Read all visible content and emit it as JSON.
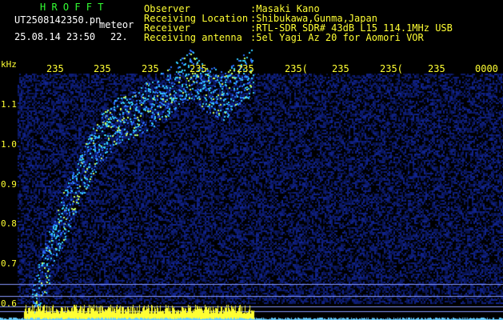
{
  "header": {
    "app_title": "H R O F F T",
    "file_name": "UT2508142350.pn",
    "event_type": "meteor",
    "date_time": "25.08.14 23:50",
    "count": "22.",
    "observer_label": "Observer",
    "observer_value": ":Masaki Kano",
    "location_label": "Receiving Location",
    "location_value": ":Shibukawa,Gunma,Japan",
    "receiver_label": "Receiver",
    "receiver_value": ":RTL-SDR SDR# 43dB L15 114.1MHz USB",
    "antenna_label": "Receiving antenna",
    "antenna_value": ":5el Yagi Az 20 for Aomori VOR"
  },
  "spectrogram": {
    "y_unit": "kHz",
    "y_ticks": [
      "1.1",
      "1.0",
      "0.9",
      "0.8",
      "0.7",
      "0.6"
    ],
    "x_ticks": [
      "235",
      "235",
      "235",
      "235",
      "235",
      "235(",
      "235",
      "235(",
      "235",
      "0000"
    ],
    "colors": {
      "background": "#000000",
      "noise": "#0a1a7a",
      "signal": "#33ccff",
      "signal_hot": "#ffff33",
      "level_bar": "#ffff33",
      "noise_floor": "#66ccff",
      "ref_line": "#8899ff"
    }
  }
}
